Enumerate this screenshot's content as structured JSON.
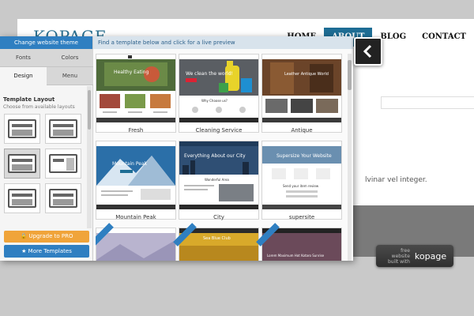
{
  "site": {
    "logo": "KOPAGE",
    "nav": [
      "HOME",
      "ABOUT",
      "BLOG",
      "CONTACT"
    ],
    "active_nav": "ABOUT",
    "body_text": "lvinar vel integer.",
    "badge_small": "free website built with",
    "badge_big": "kopage"
  },
  "panel": {
    "title": "Change website theme",
    "tabs": [
      "Fonts",
      "Colors",
      "Design",
      "Menu"
    ],
    "active_tab": "Design",
    "layout_title": "Template Layout",
    "layout_sub": "Choose from available layouts",
    "upgrade_label": "Upgrade to PRO",
    "more_label": "More Templates",
    "main_header": "Find a template below and click for a live preview",
    "templates": [
      {
        "name": "Fresh"
      },
      {
        "name": "Cleaning Service"
      },
      {
        "name": "Antique"
      },
      {
        "name": "Mountain Peak"
      },
      {
        "name": "City"
      },
      {
        "name": "supersite"
      }
    ]
  },
  "thumb_text": {
    "fresh_hero": "Healthy Eating",
    "cleaning_hero": "We clean the world!",
    "cleaning_sub": "Why Choose us?",
    "antique_hero": "Leather Antique World",
    "mountain_hero": "Mountain Peak",
    "city_hero": "Everything About our City",
    "city_sub": "Wonderful Area",
    "super_hero": "Supersize Your Website",
    "super_sub": "Send your item review",
    "row3_b": "Sea Blue Club",
    "row3_c": "Lorem Maximum Hot Kotaro Sunrise"
  },
  "colors": {
    "accent": "#2f7fc1",
    "nav_active": "#1e6d94",
    "upgrade": "#f0a43a",
    "close": "#222222"
  },
  "icons": [
    "lock-icon",
    "star-icon",
    "chevron-left-icon"
  ]
}
